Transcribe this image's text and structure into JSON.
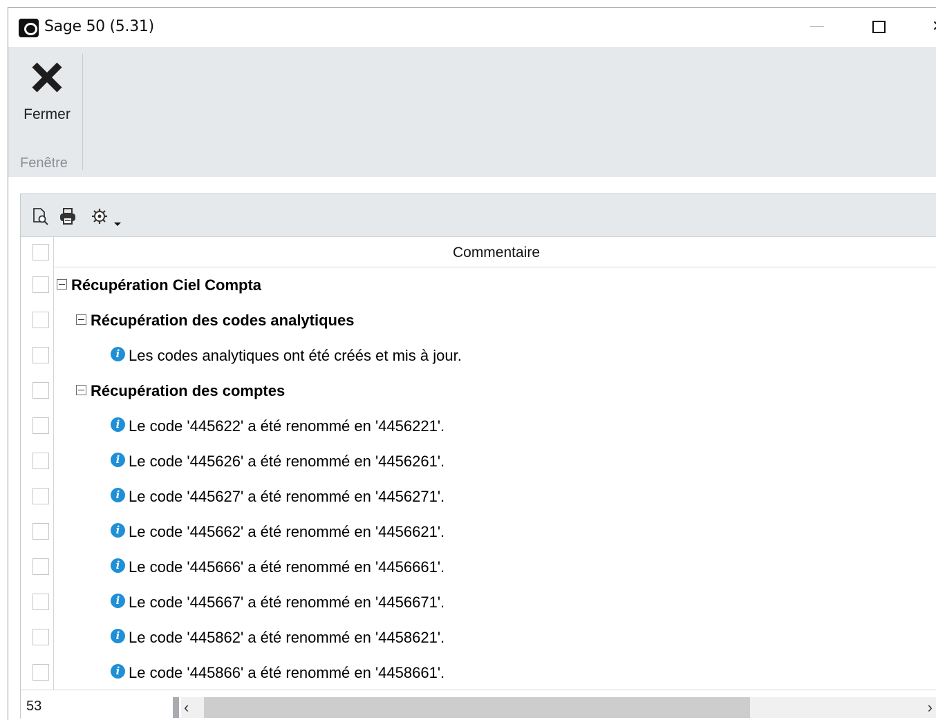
{
  "window": {
    "title": "Sage 50 (5.31)"
  },
  "ribbon": {
    "close_label": "Fermer",
    "group_label": "Fenêtre"
  },
  "toolbar": {
    "icons": [
      "preview-icon",
      "print-icon",
      "settings-icon",
      "dropdown-caret-icon"
    ]
  },
  "grid": {
    "column_header": "Commentaire",
    "rows": [
      {
        "level": 0,
        "type": "group",
        "text": "Récupération Ciel Compta"
      },
      {
        "level": 1,
        "type": "group",
        "text": "Récupération des codes analytiques"
      },
      {
        "level": 2,
        "type": "info",
        "text": "Les codes analytiques ont été créés et mis à jour."
      },
      {
        "level": 1,
        "type": "group",
        "text": "Récupération des comptes"
      },
      {
        "level": 2,
        "type": "info",
        "text": "Le code '445622' a été renommé en '4456221'."
      },
      {
        "level": 2,
        "type": "info",
        "text": "Le code '445626' a été renommé en '4456261'."
      },
      {
        "level": 2,
        "type": "info",
        "text": "Le code '445627' a été renommé en '4456271'."
      },
      {
        "level": 2,
        "type": "info",
        "text": "Le code '445662' a été renommé en '4456621'."
      },
      {
        "level": 2,
        "type": "info",
        "text": "Le code '445666' a été renommé en '4456661'."
      },
      {
        "level": 2,
        "type": "info",
        "text": "Le code '445667' a été renommé en '4456671'."
      },
      {
        "level": 2,
        "type": "info",
        "text": "Le code '445862' a été renommé en '4458621'."
      },
      {
        "level": 2,
        "type": "info",
        "text": "Le code '445866' a été renommé en '4458661'."
      }
    ]
  },
  "footer": {
    "count": "53"
  },
  "colors": {
    "ribbon_bg": "#e6e9ec",
    "info_icon": "#1f8fd6"
  }
}
